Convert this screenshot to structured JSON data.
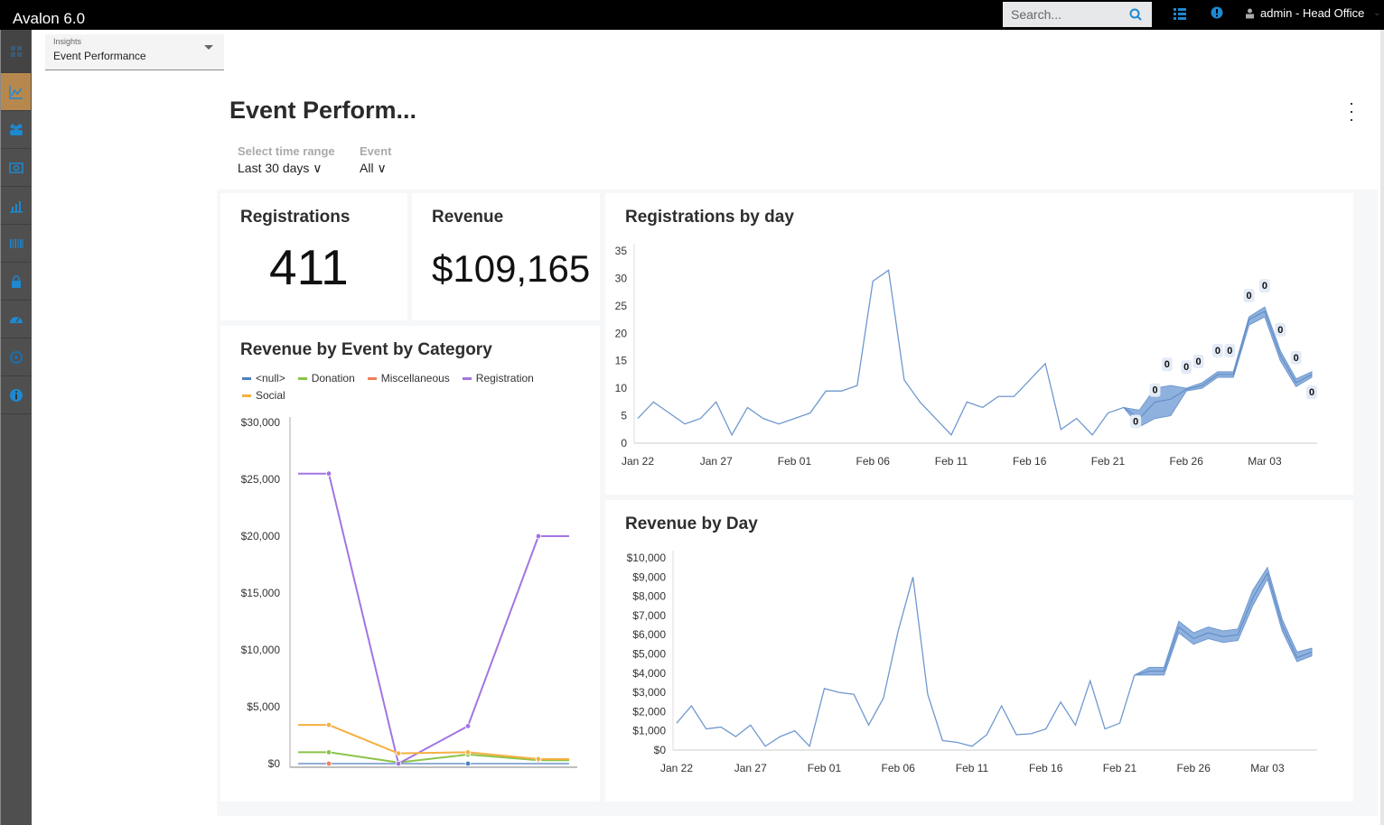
{
  "app": {
    "title": "Avalon 6.0"
  },
  "topbar": {
    "search_placeholder": "Search...",
    "user_label": "admin - Head Office",
    "icons": [
      "search-icon",
      "list-icon",
      "alert-icon",
      "user-icon",
      "chevron-down-icon"
    ]
  },
  "sidebar": {
    "items": [
      {
        "name": "home",
        "icon": "grid-icon",
        "active": false
      },
      {
        "name": "insights",
        "icon": "line-chart-icon",
        "active": true
      },
      {
        "name": "people",
        "icon": "people-icon",
        "active": false
      },
      {
        "name": "payments",
        "icon": "money-icon",
        "active": false
      },
      {
        "name": "reports",
        "icon": "bar-chart-icon",
        "active": false
      },
      {
        "name": "inventory",
        "icon": "barcode-icon",
        "active": false
      },
      {
        "name": "security",
        "icon": "lock-icon",
        "active": false
      },
      {
        "name": "dashboard",
        "icon": "gauge-icon",
        "active": false
      },
      {
        "name": "settings",
        "icon": "gear-icon",
        "active": false
      },
      {
        "name": "info",
        "icon": "info-icon",
        "active": false
      }
    ]
  },
  "insights_select": {
    "label": "Insights",
    "value": "Event Performance"
  },
  "page": {
    "title": "Event Perform...",
    "filters": [
      {
        "label": "Select time range",
        "value": "Last 30 days"
      },
      {
        "label": "Event",
        "value": "All"
      }
    ]
  },
  "kpis": {
    "registrations": {
      "title": "Registrations",
      "value": "411"
    },
    "revenue": {
      "title": "Revenue",
      "value": "$109,165"
    }
  },
  "chart_data": [
    {
      "id": "registrations-by-day",
      "type": "line",
      "title": "Registrations by day",
      "xlabel": "",
      "ylabel": "",
      "ylim": [
        0,
        35
      ],
      "yticks": [
        0,
        5,
        10,
        15,
        20,
        25,
        30,
        35
      ],
      "ytick_labels": [
        "0",
        "5",
        "10",
        "15",
        "20",
        "25",
        "30",
        "35"
      ],
      "xtick_labels": [
        "Jan 22",
        "Jan 27",
        "Feb 01",
        "Feb 06",
        "Feb 11",
        "Feb 16",
        "Feb 21",
        "Feb 26",
        "Mar 03"
      ],
      "xtick_index": [
        0,
        5,
        10,
        15,
        20,
        25,
        30,
        35,
        40
      ],
      "grid": false,
      "color": "#6f98cf",
      "values": [
        4.5,
        7.5,
        5.5,
        3.5,
        4.5,
        7.5,
        1.5,
        6.5,
        4.5,
        3.5,
        4.5,
        5.5,
        9.5,
        9.5,
        10.5,
        29.5,
        31.5,
        11.5,
        7.5,
        4.5,
        1.5,
        7.5,
        6.5,
        8.5,
        8.5,
        11.5,
        14.5,
        2.5,
        4.5,
        1.5,
        5.5,
        6.5
      ],
      "forecast": {
        "start_index": 31,
        "values": [
          6.5,
          4.5,
          7.5,
          8.0,
          9.8,
          10.5,
          12.5,
          12.5,
          22.5,
          24.0,
          16.0,
          11.0,
          12.5
        ],
        "lower": [
          6.5,
          3.0,
          4.5,
          5.0,
          9.5,
          10.0,
          12.0,
          12.0,
          21.5,
          23.0,
          15.0,
          10.3,
          12.0
        ],
        "upper": [
          6.5,
          6.0,
          10.0,
          10.5,
          10.0,
          11.0,
          13.0,
          13.0,
          23.0,
          24.8,
          16.8,
          11.7,
          13.0
        ],
        "labels": [
          "0",
          "0",
          "0",
          "0",
          "0",
          "0",
          "0",
          "0",
          "0",
          "0",
          "0",
          "0"
        ]
      }
    },
    {
      "id": "revenue-by-day",
      "type": "line",
      "title": "Revenue by Day",
      "xlabel": "",
      "ylabel": "",
      "ylim": [
        0,
        10000
      ],
      "yticks": [
        0,
        1000,
        2000,
        3000,
        4000,
        5000,
        6000,
        7000,
        8000,
        9000,
        10000
      ],
      "ytick_labels": [
        "$0",
        "$1,000",
        "$2,000",
        "$3,000",
        "$4,000",
        "$5,000",
        "$6,000",
        "$7,000",
        "$8,000",
        "$9,000",
        "$10,000"
      ],
      "xtick_labels": [
        "Jan 22",
        "Jan 27",
        "Feb 01",
        "Feb 06",
        "Feb 11",
        "Feb 16",
        "Feb 21",
        "Feb 26",
        "Mar 03"
      ],
      "xtick_index": [
        0,
        5,
        10,
        15,
        20,
        25,
        30,
        35,
        40
      ],
      "grid": false,
      "color": "#6f98cf",
      "values": [
        1400,
        2300,
        1100,
        1200,
        700,
        1300,
        200,
        700,
        1000,
        200,
        3200,
        3000,
        2900,
        1300,
        2700,
        6200,
        9000,
        2900,
        500,
        400,
        200,
        800,
        2300,
        800,
        850,
        1100,
        2500,
        1300,
        3600,
        1100,
        1400,
        3900
      ],
      "forecast": {
        "start_index": 31,
        "values": [
          3900,
          4100,
          4100,
          6400,
          5800,
          6100,
          5900,
          6000,
          7900,
          9200,
          6500,
          4800,
          5100
        ],
        "lower": [
          3900,
          3900,
          3900,
          6100,
          5500,
          5800,
          5600,
          5700,
          7500,
          8900,
          6200,
          4600,
          4900
        ],
        "upper": [
          3900,
          4300,
          4300,
          6700,
          6100,
          6400,
          6200,
          6300,
          8300,
          9500,
          6800,
          5100,
          5300
        ]
      }
    },
    {
      "id": "revenue-by-event-by-category",
      "type": "line",
      "title": "Revenue by Event by Category",
      "xlabel": "",
      "ylabel": "",
      "ylim": [
        0,
        30000
      ],
      "yticks": [
        0,
        5000,
        10000,
        15000,
        20000,
        25000,
        30000
      ],
      "ytick_labels": [
        "$0",
        "$5,000",
        "$10,000",
        "$15,000",
        "$20,000",
        "$25,000",
        "$30,000"
      ],
      "categories": [
        "",
        "",
        "",
        ""
      ],
      "legend_position": "top-left",
      "grid": false,
      "series": [
        {
          "name": "<null>",
          "color": "#4f7fc0",
          "values": [
            null,
            null,
            0,
            null
          ],
          "line": [
            0,
            0,
            0,
            0
          ]
        },
        {
          "name": "Donation",
          "color": "#8bc34a",
          "values": [
            1000,
            100,
            800,
            300
          ]
        },
        {
          "name": "Miscellaneous",
          "color": "#f07f5a",
          "values": [
            0,
            null,
            null,
            null
          ]
        },
        {
          "name": "Registration",
          "color": "#a275e3",
          "values": [
            25500,
            0,
            3300,
            20000
          ]
        },
        {
          "name": "Social",
          "color": "#f5b041",
          "values": [
            3400,
            900,
            1000,
            400
          ]
        }
      ]
    }
  ]
}
